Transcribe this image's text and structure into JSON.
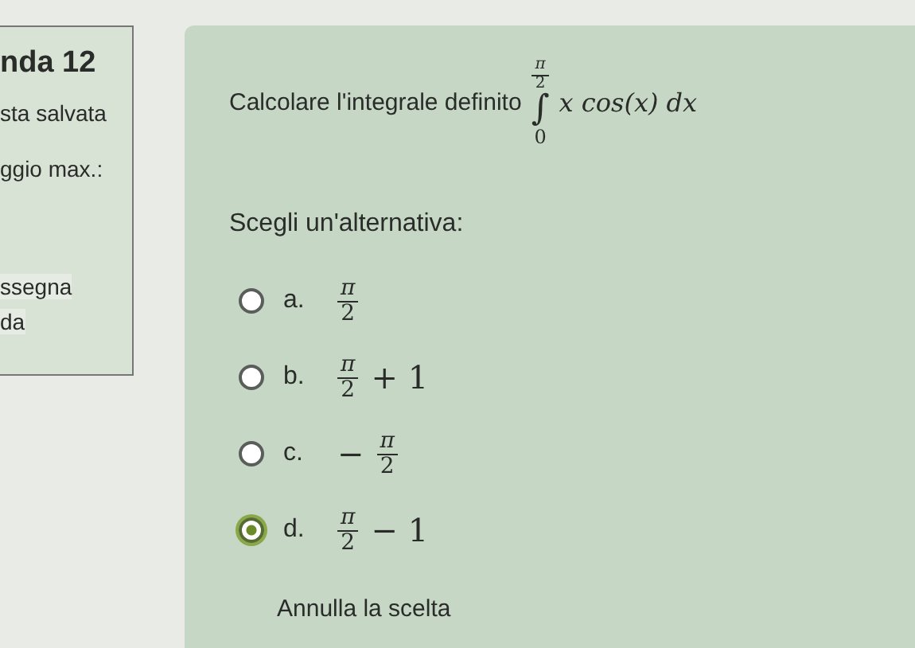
{
  "info_panel": {
    "title": "nda 12",
    "lines": [
      "sta salvata",
      "ggio max.:"
    ],
    "flags": [
      "ssegna",
      "da"
    ]
  },
  "question": {
    "text": "Calcolare l'integrale definito",
    "integral": {
      "sign": "∫",
      "upper": {
        "num": "π",
        "den": "2"
      },
      "lower": "0",
      "integrand": "x cos(x) dx"
    }
  },
  "prompt": "Scegli un'alternativa:",
  "options": [
    {
      "letter": "a.",
      "num": "π",
      "den": "2",
      "selected": false
    },
    {
      "letter": "b.",
      "num": "π",
      "den": "2",
      "suffix": "+ 1",
      "selected": false
    },
    {
      "letter": "c.",
      "prefix": "−",
      "num": "π",
      "den": "2",
      "selected": false
    },
    {
      "letter": "d.",
      "num": "π",
      "den": "2",
      "suffix": "− 1",
      "selected": true
    }
  ],
  "clear_link": "Annulla la scelta"
}
